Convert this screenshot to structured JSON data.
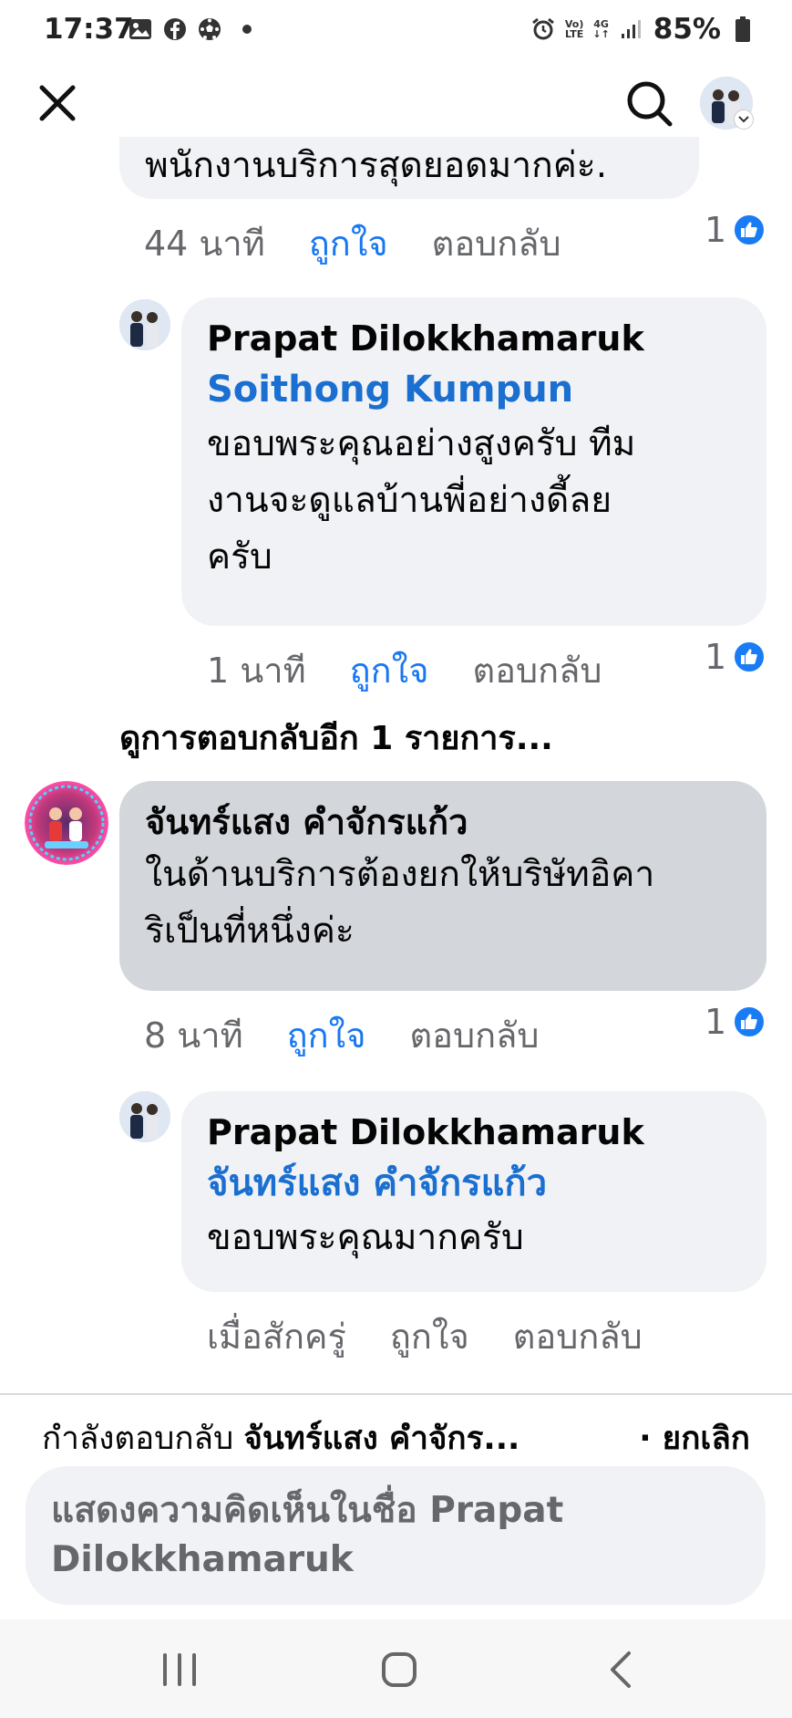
{
  "status_bar": {
    "time": "17:37",
    "battery": "85%",
    "lte_label": "Vo)\nLTE",
    "net_label": "4G"
  },
  "top_bar": {
    "close_icon": "close-icon",
    "search_icon": "search-icon"
  },
  "comments": [
    {
      "text_tail": "พนักงานบริการสุดยอดมากค่ะ.",
      "time": "44 นาที",
      "like": "ถูกใจ",
      "reply": "ตอบกลับ",
      "reactions": "1"
    },
    {
      "author": "Prapat Dilokkhamaruk",
      "mention": "Soithong Kumpun",
      "text": "ขอบพระคุณอย่างสูงครับ ทีมงานจะดูแลบ้านพี่อย่างดี้ลยครับ",
      "line1": "ขอบพระคุณอย่างสูงครับ ทีม",
      "line2": "งานจะดูแลบ้านพี่อย่างดี้ลย",
      "line3": "ครับ",
      "time": "1 นาที",
      "like": "ถูกใจ",
      "reply": "ตอบกลับ",
      "reactions": "1"
    },
    {
      "author": "จันทร์แสง คำจักรแก้ว",
      "line1": "ในด้านบริการต้องยกให้บริษัทอิคา",
      "line2": "ริเป็นที่หนึ่งค่ะ",
      "time": "8 นาที",
      "like": "ถูกใจ",
      "reply": "ตอบกลับ",
      "reactions": "1"
    },
    {
      "author": "Prapat Dilokkhamaruk",
      "mention": "จันทร์แสง คำจักรแก้ว",
      "line1": "ขอบพระคุณมากครับ",
      "time": "เมื่อสักครู่",
      "like": "ถูกใจ",
      "reply": "ตอบกลับ"
    }
  ],
  "more_replies": "ดูการตอบกลับอีก 1 รายการ...",
  "reply_bar": {
    "prefix": "กำลังตอบกลับ",
    "target": "จันทร์แสง คำจักร...",
    "cancel": "· ยกเลิก"
  },
  "input": {
    "placeholder_line1": "แสดงความคิดเห็นในชื่อ Prapat",
    "placeholder_line2": "Dilokkhamaruk"
  },
  "colors": {
    "link_blue": "#1a6fd0",
    "like_blue": "#1877f2",
    "bubble": "#f0f2f5",
    "bubble_highlight": "#d3d6db",
    "meta_gray": "#65676b"
  }
}
